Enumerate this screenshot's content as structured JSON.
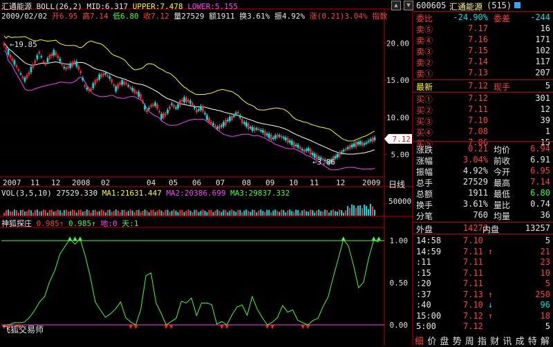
{
  "header": {
    "stock_name": "汇通能源",
    "indicator": "BOLL(26,2)",
    "mid": "MID:6.317",
    "upper": "UPPER:7.478",
    "lower": "LOWER:5.155",
    "date": "2009/02/02",
    "open": "开6.95",
    "high": "高7.14",
    "low": "低6.80",
    "close": "收7.12",
    "volume": "量27529",
    "amount": "额1911",
    "turnover": "换3.61%",
    "amplitude": "振4.92%",
    "change": "涨(0.21)3.04%",
    "index_label": "指数"
  },
  "price_axis": [
    "20.00",
    "15.00",
    "10.00",
    "5.00"
  ],
  "price_marker": "7.12",
  "annotations": {
    "high_label": "19.85",
    "low_label": "3.86"
  },
  "time_axis": [
    "2007",
    "11",
    "12",
    "2008",
    "02",
    "04",
    "05",
    "06",
    "07",
    "08",
    "09",
    "10",
    "11",
    "12",
    "2009"
  ],
  "time_axis_unit": "日线",
  "volume": {
    "title": "VOL(3,5,10)",
    "v1": "27529.330",
    "ma1": "MA1:21631.447",
    "ma2": "MA2:20386.699",
    "ma3": "MA3:29837.332",
    "axis": "50000"
  },
  "indicator_panel": {
    "name": "神狐探庄",
    "v1": "0.985",
    "v2": "0.985",
    "di": "地:0",
    "tian": "天:1",
    "axis": [
      "1.00",
      "0.50",
      "0.00"
    ],
    "watermark": "飞狐交易师"
  },
  "quote": {
    "code": "600605",
    "name": "汇通能源",
    "tag": "(515)",
    "weibi_label": "委比",
    "weibi": "-24.90%",
    "weicha_label": "委差",
    "weicha": "-244",
    "sells": [
      {
        "label": "卖⑤",
        "price": "7.17",
        "vol": "16"
      },
      {
        "label": "卖④",
        "price": "7.16",
        "vol": "171"
      },
      {
        "label": "卖③",
        "price": "7.15",
        "vol": "102"
      },
      {
        "label": "卖②",
        "price": "7.14",
        "vol": "117"
      },
      {
        "label": "卖①",
        "price": "7.13",
        "vol": "207"
      }
    ],
    "last_label": "最新",
    "last": "7.12",
    "cur_label": "现手",
    "cur": "5",
    "buys": [
      {
        "label": "买①",
        "price": "7.12",
        "vol": "301"
      },
      {
        "label": "买②",
        "price": "7.11",
        "vol": "12"
      },
      {
        "label": "买③",
        "price": "7.10",
        "vol": "39"
      },
      {
        "label": "买④",
        "price": "7.08",
        "vol": "1"
      },
      {
        "label": "买⑤",
        "price": "7.06",
        "vol": "15"
      }
    ],
    "stats": [
      {
        "l1": "涨跌",
        "v1": "0.21",
        "l2": "均价",
        "v2": "6.94",
        "c1": "red",
        "c2": "red"
      },
      {
        "l1": "涨幅",
        "v1": "3.04%",
        "l2": "前收",
        "v2": "6.91",
        "c1": "red",
        "c2": "wht"
      },
      {
        "l1": "振幅",
        "v1": "4.92%",
        "l2": "今开",
        "v2": "6.95",
        "c1": "wht",
        "c2": "red"
      },
      {
        "l1": "总手",
        "v1": "27529",
        "l2": "最高",
        "v2": "7.14",
        "c1": "wht",
        "c2": "red"
      },
      {
        "l1": "总额",
        "v1": "1911",
        "l2": "最低",
        "v2": "6.80",
        "c1": "wht",
        "c2": "grn"
      },
      {
        "l1": "换手",
        "v1": "3.61%",
        "l2": "量比",
        "v2": "0.74",
        "c1": "wht",
        "c2": "wht"
      },
      {
        "l1": "分笔",
        "v1": "760",
        "l2": "均量",
        "v2": "36",
        "c1": "wht",
        "c2": "wht"
      }
    ],
    "outer_label": "外盘",
    "outer": "14272",
    "inner_label": "内盘",
    "inner": "13257",
    "ticks": [
      {
        "t": "14:58",
        "p": "7.10",
        "arrow": "",
        "v": "5",
        "pc": "red",
        "vc": "wht"
      },
      {
        "t": "14:59",
        "p": "7.11",
        "arrow": "↑",
        "v": "21",
        "pc": "red",
        "vc": "red"
      },
      {
        "t": ":11",
        "p": "7.11",
        "arrow": "",
        "v": "23",
        "pc": "red",
        "vc": "red"
      },
      {
        "t": ":15",
        "p": "7.11",
        "arrow": "",
        "v": "10",
        "pc": "red",
        "vc": "red"
      },
      {
        "t": ":20",
        "p": "7.11",
        "arrow": "",
        "v": "5",
        "pc": "red",
        "vc": "red"
      },
      {
        "t": ":37",
        "p": "7.13",
        "arrow": "↑",
        "v": "250",
        "pc": "red",
        "vc": "red"
      },
      {
        "t": ":40",
        "p": "7.10",
        "arrow": "↓",
        "v": "96",
        "pc": "red",
        "vc": "cyan"
      },
      {
        "t": "15:00",
        "p": "7.12",
        "arrow": "↑",
        "v": "18",
        "pc": "red",
        "vc": "red"
      },
      {
        "t": "5:00",
        "p": "7.12",
        "arrow": "",
        "v": "5",
        "pc": "red",
        "vc": "wht"
      }
    ]
  },
  "bottom_nav": [
    "细",
    "价",
    "盘",
    "势",
    "周",
    "指",
    "财",
    "讯",
    "成",
    "特",
    "解"
  ],
  "chart_data": [
    {
      "type": "candlestick",
      "title": "汇通能源 BOLL(26,2)",
      "x_ticks": [
        "2007",
        "11",
        "12",
        "2008",
        "02",
        "04",
        "05",
        "06",
        "07",
        "08",
        "09",
        "10",
        "11",
        "12",
        "2009"
      ],
      "ylim": [
        2,
        23
      ],
      "yticks": [
        5,
        10,
        15,
        20
      ],
      "close_path": [
        19.85,
        18.5,
        17.4,
        16.2,
        15.0,
        16.0,
        17.3,
        18.8,
        17.0,
        18.2,
        18.8,
        17.7,
        16.5,
        16.9,
        17.5,
        16.3,
        14.0,
        13.6,
        14.8,
        15.6,
        15.9,
        15.2,
        13.8,
        14.7,
        14.6,
        13.9,
        13.4,
        12.8,
        10.8,
        11.6,
        11.8,
        10.1,
        10.5,
        11.8,
        11.2,
        12.3,
        12.4,
        11.9,
        10.8,
        11.4,
        9.9,
        9.2,
        8.6,
        8.9,
        9.6,
        10.0,
        10.8,
        9.4,
        8.9,
        8.4,
        8.5,
        8.1,
        7.6,
        7.2,
        7.6,
        7.3,
        6.9,
        6.4,
        6.1,
        5.5,
        5.7,
        4.9,
        4.6,
        4.3,
        3.86,
        4.5,
        5.0,
        5.6,
        6.0,
        6.3,
        6.6,
        6.4,
        6.9,
        7.12
      ],
      "boll": {
        "mid": 6.317,
        "upper": 7.478,
        "lower": 5.155
      },
      "annotations": [
        {
          "text": "19.85",
          "value": 19.85
        },
        {
          "text": "3.86",
          "value": 3.86
        }
      ],
      "last": 7.12
    },
    {
      "type": "bar",
      "title": "VOL(3,5,10)",
      "values_summary": {
        "vol": 27529.33,
        "ma1": 21631.447,
        "ma2": 20386.699,
        "ma3": 29837.332
      },
      "ylim": [
        0,
        70000
      ],
      "yticks": [
        50000
      ]
    },
    {
      "type": "line",
      "title": "神狐探庄",
      "series": [
        {
          "name": "神狐探庄",
          "values": [
            0.0,
            0.0,
            0.03,
            0.02,
            0.04,
            0.08,
            0.18,
            0.26,
            0.35,
            0.5,
            0.66,
            0.82,
            0.95,
            1.0,
            0.98,
            1.0,
            0.85,
            0.55,
            0.3,
            0.15,
            0.12,
            0.1,
            0.22,
            0.24,
            0.12,
            0.0,
            0.02,
            0.15,
            0.62,
            0.58,
            0.3,
            0.1,
            0.02,
            0.0,
            0.12,
            0.24,
            0.3,
            0.28,
            0.15,
            0.22,
            0.3,
            0.2,
            0.05,
            0.0,
            0.0,
            0.08,
            0.25,
            0.2,
            0.15,
            0.3,
            0.22,
            0.05,
            0.0,
            0.0,
            0.12,
            0.2,
            0.18,
            0.15,
            0.08,
            0.0,
            0.0,
            0.03,
            0.1,
            0.2,
            0.35,
            0.55,
            0.8,
            1.0,
            0.95,
            0.7,
            0.45,
            0.5,
            0.8,
            1.0,
            0.985
          ]
        }
      ],
      "ylim": [
        0,
        1.1
      ],
      "yticks": [
        0,
        0.5,
        1.0
      ],
      "levels": {
        "di": 0,
        "tian": 1
      }
    }
  ]
}
